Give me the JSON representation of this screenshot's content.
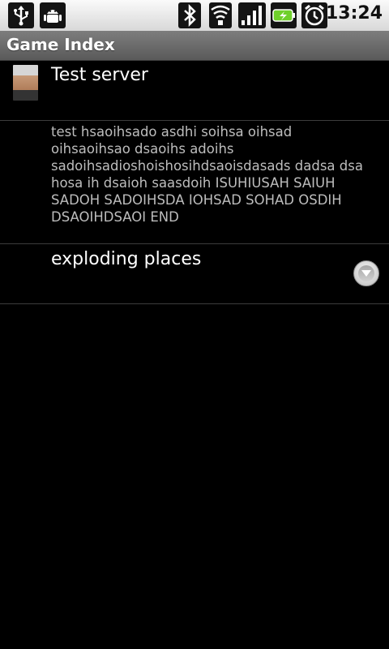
{
  "status_bar": {
    "time": "13:24",
    "icons": [
      "usb-icon",
      "android-debug-icon",
      "bluetooth-icon",
      "wifi-icon",
      "signal-icon",
      "battery-charging-icon",
      "alarm-icon"
    ]
  },
  "app": {
    "title": "Game Index"
  },
  "list": {
    "items": [
      {
        "title": "Test server"
      },
      {
        "description": "test hsaoihsado asdhi soihsa oihsad oihsaoihsao dsaoihs adoihs sadoihsadioshoishosihdsaoisdasads dadsa dsa hosa ih dsaioh saasdoih ISUHIUSAH SAIUH SADOH SADOIHSDA IOHSAD SOHAD OSDIH DSAOIHDSAOI END"
      },
      {
        "title": "exploding places"
      }
    ]
  }
}
